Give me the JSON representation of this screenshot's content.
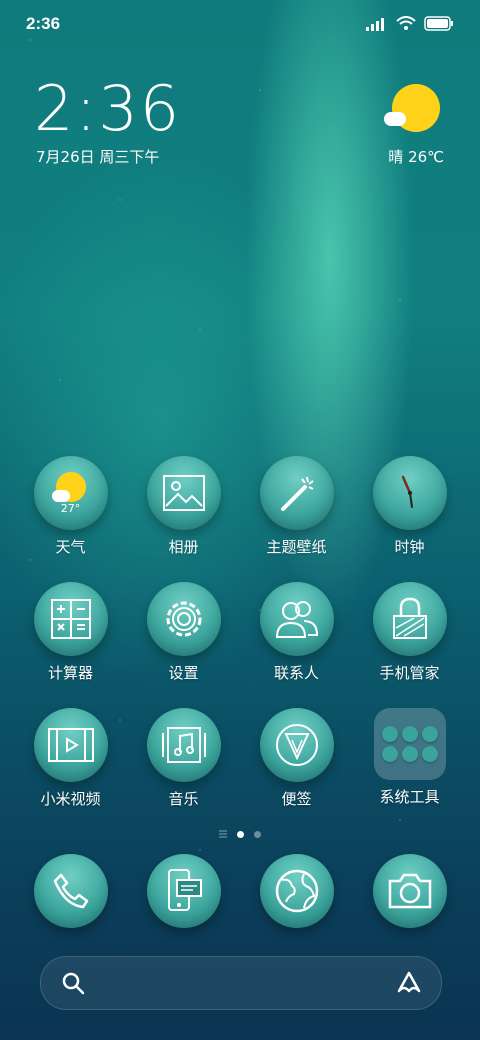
{
  "status": {
    "time": "2:36"
  },
  "clock": {
    "time": "2:36",
    "date": "7月26日 周三下午"
  },
  "weather_widget": {
    "text": "晴 26℃"
  },
  "apps": [
    {
      "label": "天气",
      "icon": "weather-icon",
      "temp": "27°"
    },
    {
      "label": "相册",
      "icon": "gallery-icon"
    },
    {
      "label": "主题壁纸",
      "icon": "magic-wand-icon"
    },
    {
      "label": "时钟",
      "icon": "clock-icon"
    },
    {
      "label": "计算器",
      "icon": "calculator-icon"
    },
    {
      "label": "设置",
      "icon": "gear-icon"
    },
    {
      "label": "联系人",
      "icon": "contacts-icon"
    },
    {
      "label": "手机管家",
      "icon": "lock-icon"
    },
    {
      "label": "小米视频",
      "icon": "video-icon"
    },
    {
      "label": "音乐",
      "icon": "music-icon"
    },
    {
      "label": "便签",
      "icon": "notes-icon"
    },
    {
      "label": "系统工具",
      "icon": "folder-icon"
    }
  ],
  "dock": [
    {
      "icon": "phone-icon"
    },
    {
      "icon": "messages-icon"
    },
    {
      "icon": "browser-icon"
    },
    {
      "icon": "camera-icon"
    }
  ],
  "colors": {
    "accent": "#3aa39c",
    "sun": "#ffd21a"
  }
}
